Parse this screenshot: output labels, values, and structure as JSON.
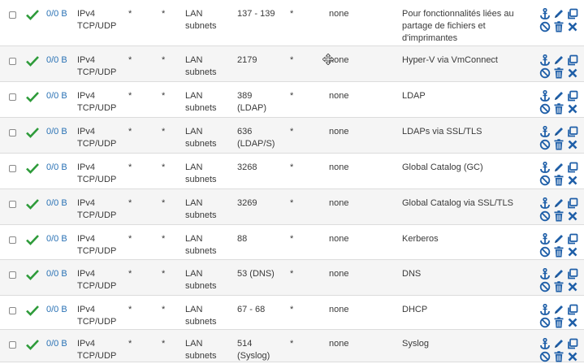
{
  "rules": [
    {
      "states": "0/0 B",
      "protocol": [
        "IPv4",
        "TCP/UDP"
      ],
      "source": "*",
      "source_port": "*",
      "destination": [
        "LAN",
        "subnets"
      ],
      "dest_port": [
        "137 - 139"
      ],
      "gateway": "*",
      "queue": "none",
      "description": "Pour fonctionnalités liées au partage de fichiers et d'imprimantes"
    },
    {
      "states": "0/0 B",
      "protocol": [
        "IPv4",
        "TCP/UDP"
      ],
      "source": "*",
      "source_port": "*",
      "destination": [
        "LAN",
        "subnets"
      ],
      "dest_port": [
        "2179"
      ],
      "gateway": "*",
      "queue": "none",
      "description": "Hyper-V via VmConnect"
    },
    {
      "states": "0/0 B",
      "protocol": [
        "IPv4",
        "TCP/UDP"
      ],
      "source": "*",
      "source_port": "*",
      "destination": [
        "LAN",
        "subnets"
      ],
      "dest_port": [
        "389",
        "(LDAP)"
      ],
      "gateway": "*",
      "queue": "none",
      "description": "LDAP"
    },
    {
      "states": "0/0 B",
      "protocol": [
        "IPv4",
        "TCP/UDP"
      ],
      "source": "*",
      "source_port": "*",
      "destination": [
        "LAN",
        "subnets"
      ],
      "dest_port": [
        "636",
        "(LDAP/S)"
      ],
      "gateway": "*",
      "queue": "none",
      "description": "LDAPs via SSL/TLS"
    },
    {
      "states": "0/0 B",
      "protocol": [
        "IPv4",
        "TCP/UDP"
      ],
      "source": "*",
      "source_port": "*",
      "destination": [
        "LAN",
        "subnets"
      ],
      "dest_port": [
        "3268"
      ],
      "gateway": "*",
      "queue": "none",
      "description": "Global Catalog (GC)"
    },
    {
      "states": "0/0 B",
      "protocol": [
        "IPv4",
        "TCP/UDP"
      ],
      "source": "*",
      "source_port": "*",
      "destination": [
        "LAN",
        "subnets"
      ],
      "dest_port": [
        "3269"
      ],
      "gateway": "*",
      "queue": "none",
      "description": "Global Catalog via SSL/TLS"
    },
    {
      "states": "0/0 B",
      "protocol": [
        "IPv4",
        "TCP/UDP"
      ],
      "source": "*",
      "source_port": "*",
      "destination": [
        "LAN",
        "subnets"
      ],
      "dest_port": [
        "88"
      ],
      "gateway": "*",
      "queue": "none",
      "description": "Kerberos"
    },
    {
      "states": "0/0 B",
      "protocol": [
        "IPv4",
        "TCP/UDP"
      ],
      "source": "*",
      "source_port": "*",
      "destination": [
        "LAN",
        "subnets"
      ],
      "dest_port": [
        "53 (DNS)"
      ],
      "gateway": "*",
      "queue": "none",
      "description": "DNS"
    },
    {
      "states": "0/0 B",
      "protocol": [
        "IPv4",
        "TCP/UDP"
      ],
      "source": "*",
      "source_port": "*",
      "destination": [
        "LAN",
        "subnets"
      ],
      "dest_port": [
        "67 - 68"
      ],
      "gateway": "*",
      "queue": "none",
      "description": "DHCP"
    },
    {
      "states": "0/0 B",
      "protocol": [
        "IPv4",
        "TCP/UDP"
      ],
      "source": "*",
      "source_port": "*",
      "destination": [
        "LAN",
        "subnets"
      ],
      "dest_port": [
        "514",
        "(Syslog)"
      ],
      "gateway": "*",
      "queue": "none",
      "description": "Syslog"
    }
  ],
  "colors": {
    "pass": "#2e9b3a",
    "link": "#2a72b5",
    "action": "#1f5fa8",
    "delete": "#1f5fa8"
  },
  "icons": {
    "status": "check-icon",
    "actions": [
      "anchor-icon",
      "pencil-icon",
      "copy-icon",
      "disable-icon",
      "trash-icon",
      "close-icon"
    ],
    "cursor": "move-cursor-icon"
  }
}
